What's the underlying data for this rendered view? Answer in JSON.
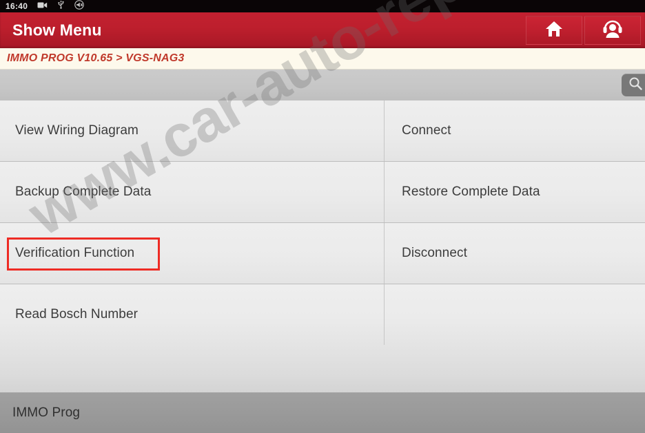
{
  "statusbar": {
    "time": "16:40",
    "icons": [
      "screen-record-icon",
      "usb-icon",
      "mute-icon"
    ]
  },
  "titlebar": {
    "title": "Show Menu",
    "home_icon": "home-icon",
    "support_icon": "headset-support-icon",
    "bg_color": "#bd1f2d"
  },
  "breadcrumb": {
    "text": "IMMO PROG V10.65 > VGS-NAG3",
    "color": "#c0392b"
  },
  "toolbar": {
    "search_icon": "search-icon"
  },
  "menu": {
    "highlight_color": "#ee2b24",
    "rows": [
      {
        "left": "View Wiring Diagram",
        "right": "Connect"
      },
      {
        "left": "Backup Complete Data",
        "right": "Restore Complete Data"
      },
      {
        "left": "Verification Function",
        "right": "Disconnect"
      },
      {
        "left": "Read Bosch Number",
        "right": ""
      }
    ]
  },
  "bottombar": {
    "label": "IMMO Prog"
  },
  "watermark": {
    "text": "www.car-auto-repair.com"
  }
}
